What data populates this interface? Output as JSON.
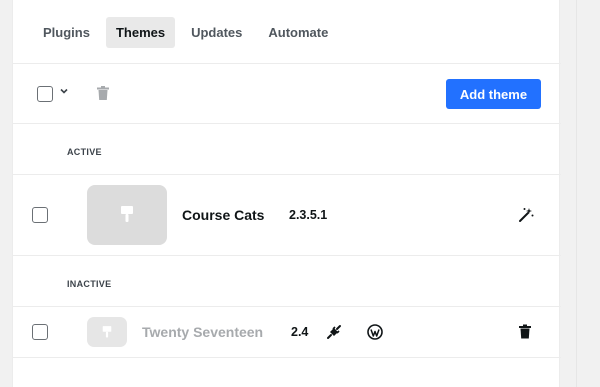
{
  "tabs": [
    {
      "label": "Plugins"
    },
    {
      "label": "Themes"
    },
    {
      "label": "Updates"
    },
    {
      "label": "Automate"
    }
  ],
  "toolbar": {
    "add_theme_label": "Add theme",
    "accent_color": "#2271ff"
  },
  "sections": {
    "active": {
      "label": "ACTIVE",
      "themes": [
        {
          "name": "Course Cats",
          "version": "2.3.5.1"
        }
      ]
    },
    "inactive": {
      "label": "INACTIVE",
      "themes": [
        {
          "name": "Twenty Seventeen",
          "version": "2.4"
        }
      ]
    }
  }
}
